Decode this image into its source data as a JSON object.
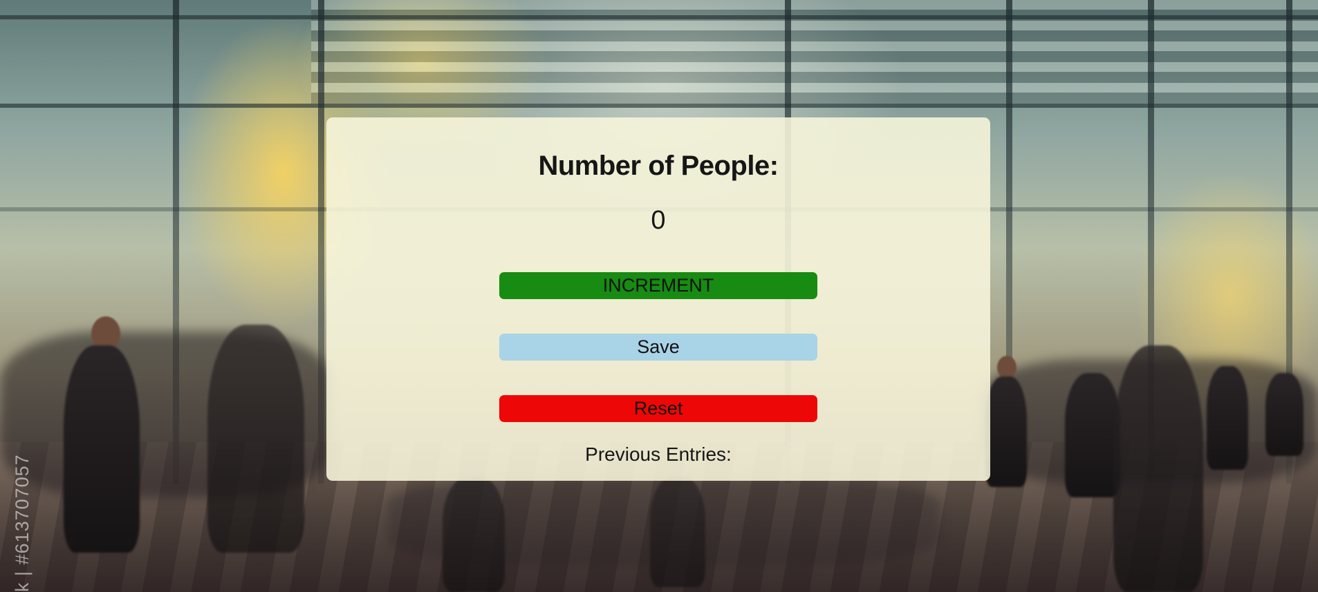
{
  "counter": {
    "title": "Number of People:",
    "count": "0",
    "increment_label": "INCREMENT",
    "save_label": "Save",
    "reset_label": "Reset",
    "previous_entries_label": "Previous Entries:"
  },
  "background": {
    "watermark_text": "k | #613707057"
  },
  "colors": {
    "increment": "#178b12",
    "save": "#a9d3e6",
    "reset": "#ee0707",
    "card": "#f8f6dc"
  }
}
